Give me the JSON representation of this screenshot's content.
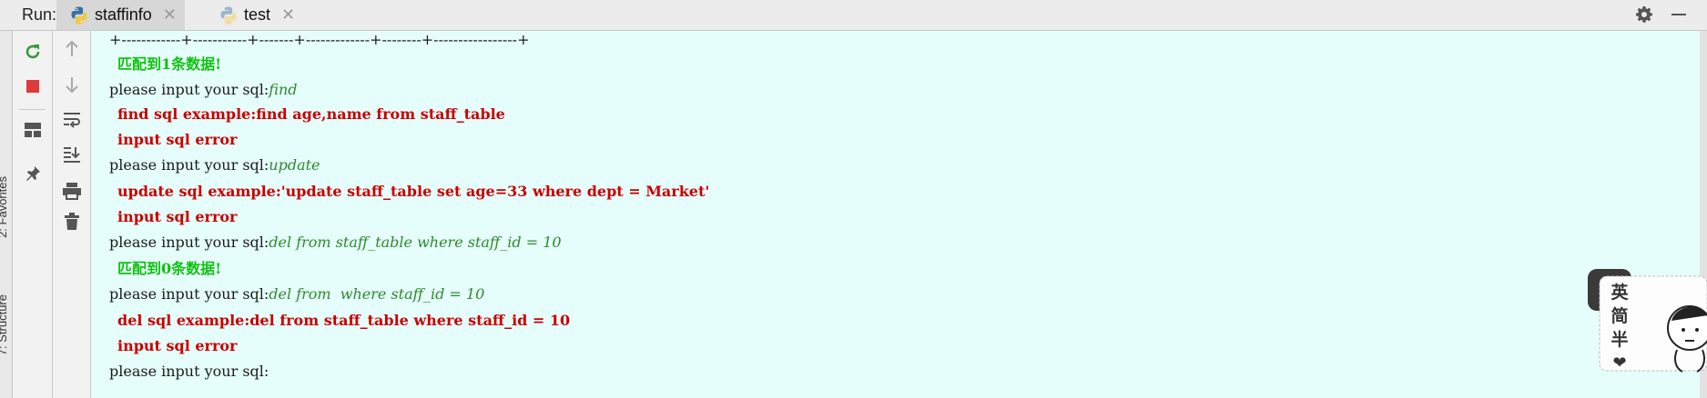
{
  "toolbar": {
    "run_label": "Run:",
    "tabs": [
      {
        "label": "staffinfo",
        "active": true,
        "icon": "python-icon"
      },
      {
        "label": "test",
        "active": false,
        "icon": "python-icon"
      }
    ],
    "right_icons": [
      "gear-icon",
      "minimize-icon"
    ]
  },
  "left_strip": {
    "vertical_tabs": [
      "7: Structure",
      "2: Favorites"
    ]
  },
  "side_tools": {
    "col1": [
      "rerun-icon",
      "stop-icon",
      "layout-icon",
      "pin-icon"
    ],
    "col2": [
      "up-arrow-icon",
      "down-arrow-icon",
      "soft-wrap-icon",
      "scroll-to-end-icon",
      "print-icon",
      "trash-icon"
    ]
  },
  "console": {
    "lines": [
      {
        "kind": "border",
        "text": "+------------+-----------+-------+-------------+--------+-----------------+"
      },
      {
        "kind": "ok",
        "text": "匹配到1条数据!"
      },
      {
        "kind": "prompt",
        "prompt": "please input your sql:",
        "input": "find"
      },
      {
        "kind": "err",
        "text": "find sql example:find age,name from staff_table"
      },
      {
        "kind": "err",
        "text": "input sql error"
      },
      {
        "kind": "prompt",
        "prompt": "please input your sql:",
        "input": "update"
      },
      {
        "kind": "err",
        "text": "update sql example:'update staff_table set age=33 where dept = Market'"
      },
      {
        "kind": "err",
        "text": "input sql error"
      },
      {
        "kind": "prompt",
        "prompt": "please input your sql:",
        "input": "del from staff_table where staff_id = 10"
      },
      {
        "kind": "ok",
        "text": "匹配到0条数据!"
      },
      {
        "kind": "prompt",
        "prompt": "please input your sql:",
        "input": "del from  where staff_id = 10"
      },
      {
        "kind": "err",
        "text": "del sql example:del from staff_table where staff_id = 10"
      },
      {
        "kind": "err",
        "text": "input sql error"
      },
      {
        "kind": "prompt",
        "prompt": "please input your sql:",
        "input": ""
      }
    ]
  },
  "sticker": {
    "chars": [
      "英",
      "简",
      "半"
    ],
    "heart": "❤"
  },
  "colors": {
    "console_bg": "#e5fdfb",
    "error_text": "#c90000",
    "success_text": "#10c210",
    "input_text": "#2f8a2c"
  }
}
